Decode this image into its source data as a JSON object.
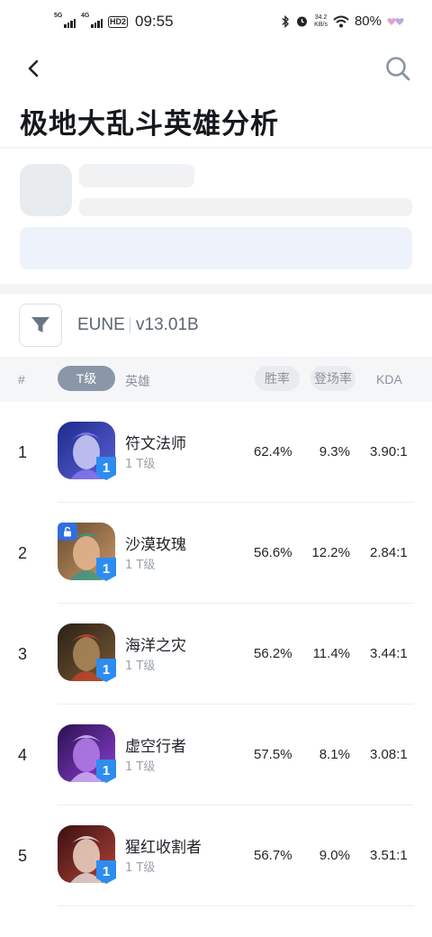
{
  "status_bar": {
    "sim1": "5G",
    "sim2": "4G",
    "hd": "HD2",
    "time": "09:55",
    "net_speed_value": "34.2",
    "net_speed_unit": "KB/s",
    "battery": "80%"
  },
  "header": {
    "title": "极地大乱斗英雄分析"
  },
  "filter": {
    "region": "EUNE",
    "version": "v13.01B"
  },
  "table_header": {
    "rank": "#",
    "tier": "T级",
    "hero": "英雄",
    "win_rate": "胜率",
    "pick_rate": "登场率",
    "kda": "KDA"
  },
  "rows": [
    {
      "rank": "1",
      "name": "符文法师",
      "tier_label": "1 T级",
      "tier": "1",
      "win_rate": "62.4%",
      "pick_rate": "9.3%",
      "kda": "3.90:1",
      "locked": false
    },
    {
      "rank": "2",
      "name": "沙漠玫瑰",
      "tier_label": "1 T级",
      "tier": "1",
      "win_rate": "56.6%",
      "pick_rate": "12.2%",
      "kda": "2.84:1",
      "locked": true
    },
    {
      "rank": "3",
      "name": "海洋之灾",
      "tier_label": "1 T级",
      "tier": "1",
      "win_rate": "56.2%",
      "pick_rate": "11.4%",
      "kda": "3.44:1",
      "locked": false
    },
    {
      "rank": "4",
      "name": "虚空行者",
      "tier_label": "1 T级",
      "tier": "1",
      "win_rate": "57.5%",
      "pick_rate": "8.1%",
      "kda": "3.08:1",
      "locked": false
    },
    {
      "rank": "5",
      "name": "猩红收割者",
      "tier_label": "1 T级",
      "tier": "1",
      "win_rate": "56.7%",
      "pick_rate": "9.0%",
      "kda": "3.51:1",
      "locked": false
    }
  ],
  "colors": {
    "tier_badge": "#2d8cf0",
    "lock_badge": "#2f6fe0",
    "tier_pill": "#8a97a8"
  }
}
